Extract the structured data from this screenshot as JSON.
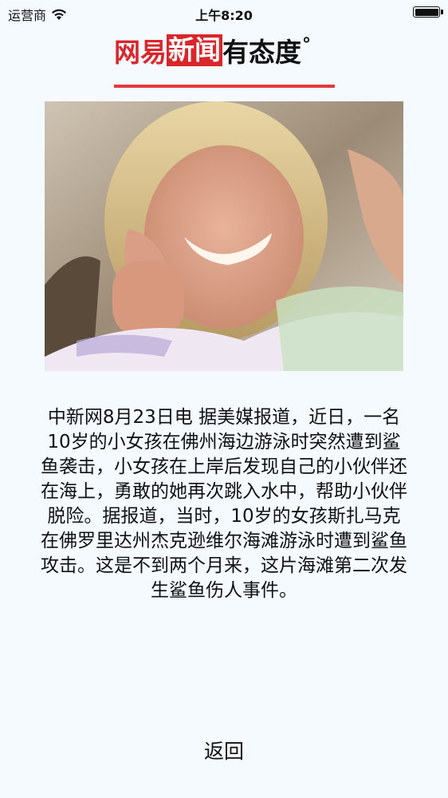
{
  "status_bar": {
    "carrier": "运营商",
    "time": "上午8:20",
    "icons": [
      "wifi-icon",
      "battery-icon"
    ]
  },
  "header": {
    "logo_part_1": "网易",
    "logo_part_2": "新闻",
    "logo_part_3": "有态度",
    "logo_mark": "°",
    "brand_color": "#d9262b",
    "line_color": "#e23a3a"
  },
  "article": {
    "body": "中新网8月23日电 据美媒报道，近日，一名10岁的小女孩在佛州海边游泳时突然遭到鲨鱼袭击，小女孩在上岸后发现自己的小伙伴还在海上，勇敢的她再次跳入水中，帮助小伙伴脱险。据报道，当时，10岁的女孩斯扎马克在佛罗里达州杰克逊维尔海滩游泳时遭到鲨鱼攻击。这是不到两个月来，这片海滩第二次发生鲨鱼伤人事件。"
  },
  "actions": {
    "back_label": "返回"
  },
  "colors": {
    "background": "#f4faff",
    "text": "#111111"
  }
}
